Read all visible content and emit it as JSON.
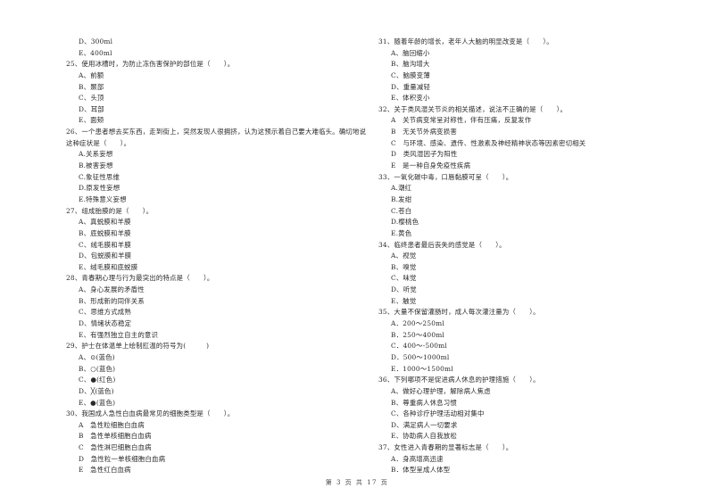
{
  "left_column": {
    "lead_options": [
      "D、300ml",
      "E、400ml"
    ],
    "questions": [
      {
        "stem": "25、使用冰槽时，为防止冻伤害保护的部位是（　　）。",
        "options": [
          "A、前额",
          "B、颞部",
          "C、头顶",
          "D、耳部",
          "E、面颊"
        ]
      },
      {
        "stem": "26、一个患者想去买东西，走到街上，突然发现人很拥挤，认为这预示着自己要大难临头。确切地说这种症状是（　　）。",
        "options": [
          "A.关系妄想",
          "B.被害妄想",
          "C.象征性思维",
          "D.原发性妄想",
          "E.特殊意义妄想"
        ]
      },
      {
        "stem": "27、组成胎膜的是（　　）。",
        "options": [
          "A、真蜕膜和羊膜",
          "B、底蜕膜和羊膜",
          "C、绒毛膜和羊膜",
          "D、包蜕膜和羊膜",
          "E、绒毛膜和底蜕膜"
        ]
      },
      {
        "stem": "28、青春期心理与行为最突出的特点是（　　）。",
        "options": [
          "A、身心发展的矛盾性",
          "B、形成新的同伴关系",
          "C、思维方式成熟",
          "D、情绪状态稳定",
          "E、有强烈独立自主的意识"
        ]
      },
      {
        "stem": "29、护士在体温单上绘制肛温的符号为(　　　)",
        "options": [
          "A、⊙(蓝色)",
          "B、○(蓝色)",
          "C、●(红色)",
          "D、╳(蓝色)",
          "E、●(蓝色)"
        ]
      },
      {
        "stem": "30、我国成人急性白血病最常见的细胞类型是（　　）。",
        "options": [
          "A　急性粒细胞白血病",
          "B　急性单核细胞白血病",
          "C　急性淋巴细胞白血病",
          "D　急性粒一单核细胞白血病",
          "E　急性红白血病"
        ]
      }
    ]
  },
  "right_column": {
    "questions": [
      {
        "stem": "31、随着年龄的增长，老年人大脑的明显改变是（　　）。",
        "options": [
          "A、脑回缩小",
          "B、脑沟增大",
          "C、脑膜变薄",
          "D、重量减轻",
          "E、体积变小"
        ]
      },
      {
        "stem": "32、关于类风湿关节炎的相关描述，说法不正确的是（　　）。",
        "options": [
          "A　关节病变常呈对称性，伴有压痛，反复发作",
          "B　无关节外病变损害",
          "C　与环境、感染、遗传、性激素及神经精神状态等因素密切相关",
          "D　类风湿因子为阳性",
          "E　是一种自身免疫性疾病"
        ]
      },
      {
        "stem": "33、一氧化碳中毒，口唇黏膜可呈（　　）。",
        "options": [
          "A.潮红",
          "B.发绀",
          "C.苍白",
          "D.樱桃色",
          "E.黄色"
        ]
      },
      {
        "stem": "34、临终患者最后丧失的感觉是（　　）。",
        "options": [
          "A、视觉",
          "B、嗅觉",
          "C、味觉",
          "D、听觉",
          "E、触觉"
        ]
      },
      {
        "stem": "35、大量不保留灌肠时，成人每次灌注量为（　　）。",
        "options": [
          "A．200～250ml",
          "B．250～400ml",
          "C．400～-500ml",
          "D．500～1000ml",
          "E．1000～1500ml"
        ]
      },
      {
        "stem": "36、下列哪项不是促进病人休息的护理措施（　　）。",
        "options": [
          "A、做好心理护理，解除病人焦虑",
          "B、尊重病人休息习惯",
          "C、各种诊疗护理活动相对集中",
          "D、满足病人一切要求",
          "E、协助病人自我放松"
        ]
      },
      {
        "stem": "37、女性进入青春期的显著标志是（　　）。",
        "options": [
          "A．身高增高迅速",
          "B．体型呈成人体型"
        ]
      }
    ]
  },
  "footer": {
    "page_label": "第 3 页 共 17 页"
  }
}
